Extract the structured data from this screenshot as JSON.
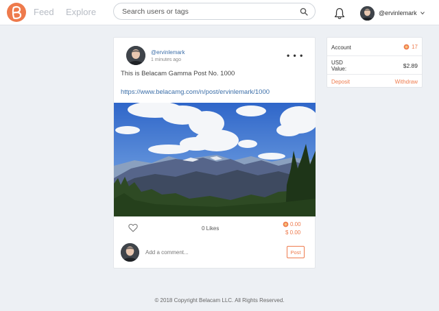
{
  "header": {
    "nav": {
      "feed_label": "Feed",
      "explore_label": "Explore"
    },
    "search": {
      "placeholder": "Search users or tags",
      "value": ""
    },
    "user": {
      "username": "@ervinlemark"
    }
  },
  "post": {
    "author": "@ervinlemark",
    "time": "1 minutes ago",
    "text": "This is Belacam Gamma Post No. 1000",
    "link": "https://www.belacamg.com/n/post/ervinlemark/1000",
    "likes": "0 Likes",
    "tokens": "0.00",
    "usd": "$ 0.00",
    "comment_placeholder": "Add a comment...",
    "post_button_label": "Post",
    "more_label": "• • •"
  },
  "account": {
    "title": "Account",
    "token_balance": "17",
    "usd_label": "USD Value:",
    "usd_value": "$2.89",
    "deposit_label": "Deposit",
    "withdraw_label": "Withdraw"
  },
  "footer": {
    "copyright": "© 2018 Copyright Belacam LLC. All Rights Reserved."
  },
  "colors": {
    "accent": "#ee7a4c",
    "link": "#3b6ea8",
    "background": "#edf0f4"
  },
  "icons": [
    "belacam-logo-icon",
    "search-icon",
    "bell-icon",
    "chevron-down-icon",
    "heart-icon",
    "token-icon",
    "avatar"
  ]
}
